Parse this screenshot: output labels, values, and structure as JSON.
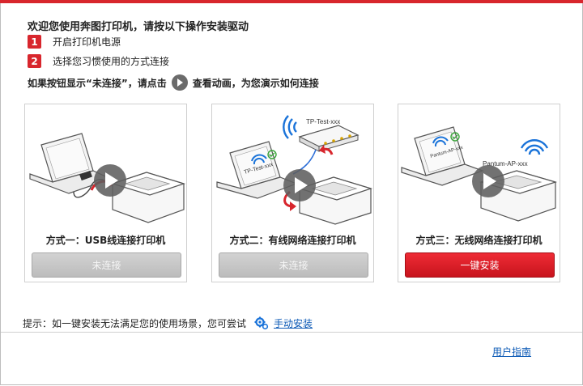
{
  "header": {
    "title": "欢迎您使用奔图打印机，请按以下操作安装驱动"
  },
  "steps": [
    {
      "num": "1",
      "text": "开启打印机电源"
    },
    {
      "num": "2",
      "text": "选择您习惯使用的方式连接"
    }
  ],
  "hint": {
    "before": "如果按钮显示“未连接”，请点击",
    "after": "查看动画，为您演示如何连接"
  },
  "methods": [
    {
      "label": "方式一：USB线连接打印机",
      "button": "未连接",
      "state": "disconnected"
    },
    {
      "label": "方式二：有线网络连接打印机",
      "button": "未连接",
      "state": "disconnected",
      "router_text": "TP-Test-xxx",
      "laptop_text": "TP-Test-xxx"
    },
    {
      "label": "方式三：无线网络连接打印机",
      "button": "一键安装",
      "state": "install",
      "laptop_text": "Pantum-AP-xxx",
      "ap_text": "Pantum-AP-xxx"
    }
  ],
  "footer": {
    "hint": "提示：如一键安装无法满足您的使用场景，您可尝试",
    "manual_link": "手动安装",
    "user_guide": "用户指南"
  },
  "colors": {
    "brand_red": "#d8262d",
    "button_gray": "#c6c6c6",
    "link_blue": "#0a58b5",
    "wifi_blue": "#1a73d9",
    "check_green": "#3aa53a"
  },
  "icons": [
    "play-icon",
    "gear-icon",
    "wifi-icon",
    "check-icon"
  ]
}
